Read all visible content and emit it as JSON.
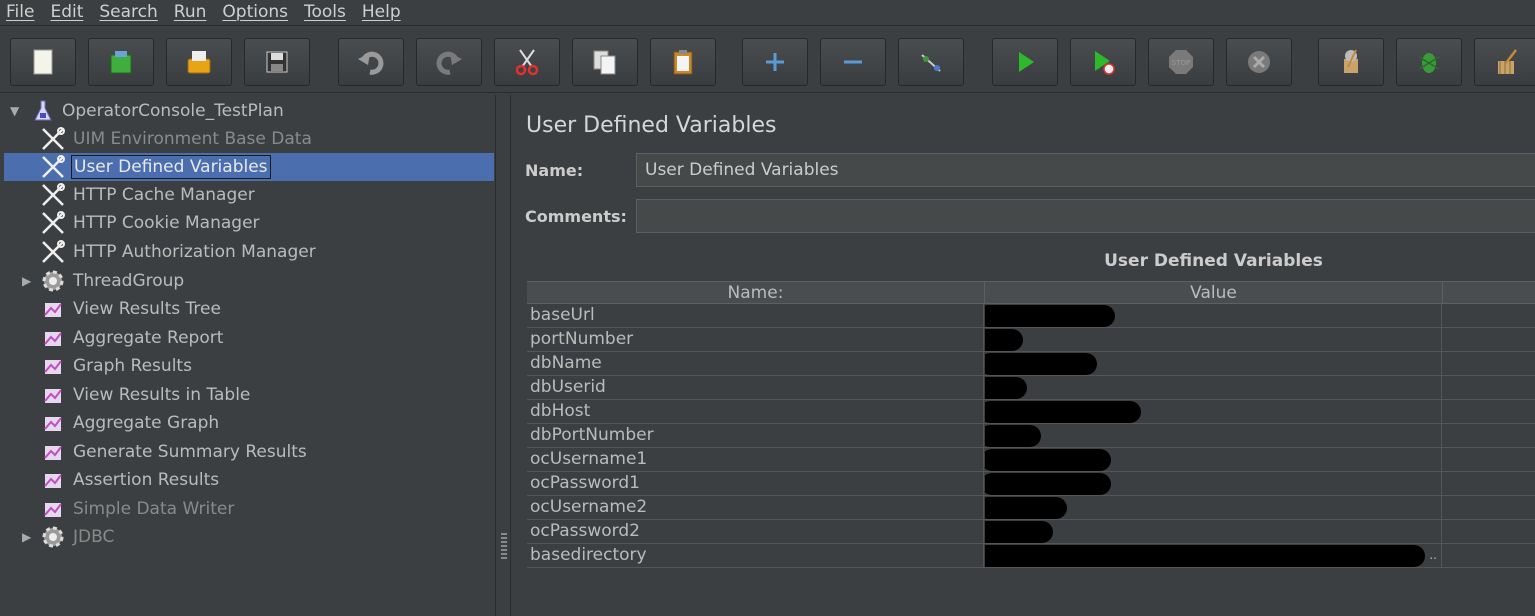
{
  "menu": [
    "File",
    "Edit",
    "Search",
    "Run",
    "Options",
    "Tools",
    "Help"
  ],
  "toolbar": {
    "buttons": [
      "new-icon",
      "templates-icon",
      "open-icon",
      "save-icon",
      "undo-icon",
      "redo-icon",
      "cut-icon",
      "copy-icon",
      "paste-icon",
      "expand-icon",
      "collapse-icon",
      "toggle-icon",
      "start-icon",
      "start-no-pauses-icon",
      "stop-icon",
      "shutdown-icon",
      "clear-icon",
      "clear-all-icon",
      "broom-icon"
    ],
    "stop_label": "STOP"
  },
  "tree": {
    "root": "OperatorConsole_TestPlan",
    "items": [
      {
        "label": "UIM Environment Base Data",
        "icon": "config-element-icon",
        "disabled": true
      },
      {
        "label": "User Defined Variables",
        "icon": "config-element-icon",
        "selected": true
      },
      {
        "label": "HTTP Cache Manager",
        "icon": "config-element-icon"
      },
      {
        "label": "HTTP Cookie Manager",
        "icon": "config-element-icon"
      },
      {
        "label": "HTTP Authorization Manager",
        "icon": "config-element-icon"
      },
      {
        "label": "ThreadGroup",
        "icon": "thread-group-icon",
        "collapsed": true
      },
      {
        "label": "View Results Tree",
        "icon": "listener-icon"
      },
      {
        "label": "Aggregate Report",
        "icon": "listener-icon"
      },
      {
        "label": "Graph Results",
        "icon": "listener-icon"
      },
      {
        "label": "View Results in Table",
        "icon": "listener-icon"
      },
      {
        "label": "Aggregate Graph",
        "icon": "listener-icon"
      },
      {
        "label": "Generate Summary Results",
        "icon": "listener-icon"
      },
      {
        "label": "Assertion Results",
        "icon": "listener-icon"
      },
      {
        "label": "Simple Data Writer",
        "icon": "listener-icon",
        "disabled": true
      },
      {
        "label": "JDBC",
        "icon": "thread-group-icon",
        "collapsed": true,
        "disabled": true
      }
    ]
  },
  "panel": {
    "title": "User Defined Variables",
    "name_label": "Name:",
    "name_value": "User Defined Variables",
    "comments_label": "Comments:",
    "comments_value": "",
    "table_caption": "User Defined Variables",
    "columns": [
      "Name:",
      "Value",
      ""
    ],
    "rows": [
      {
        "name": "baseUrl",
        "value": "[redacted]"
      },
      {
        "name": "portNumber",
        "value": "[redacted]"
      },
      {
        "name": "dbName",
        "value": "[redacted]"
      },
      {
        "name": "dbUserid",
        "value": "[redacted]"
      },
      {
        "name": "dbHost",
        "value": "[redacted]"
      },
      {
        "name": "dbPortNumber",
        "value": "[redacted]"
      },
      {
        "name": "ocUsername1",
        "value": "[redacted]"
      },
      {
        "name": "ocPassword1",
        "value": "[redacted]"
      },
      {
        "name": "ocUsername2",
        "value": "[redacted]"
      },
      {
        "name": "ocPassword2",
        "value": "[redacted]"
      },
      {
        "name": "basedirectory",
        "value": "[redacted]"
      }
    ],
    "truncation_mark": ".."
  },
  "colors": {
    "background": "#3c3f41",
    "selection": "#4b6eaf",
    "run_green": "#2db82d"
  }
}
